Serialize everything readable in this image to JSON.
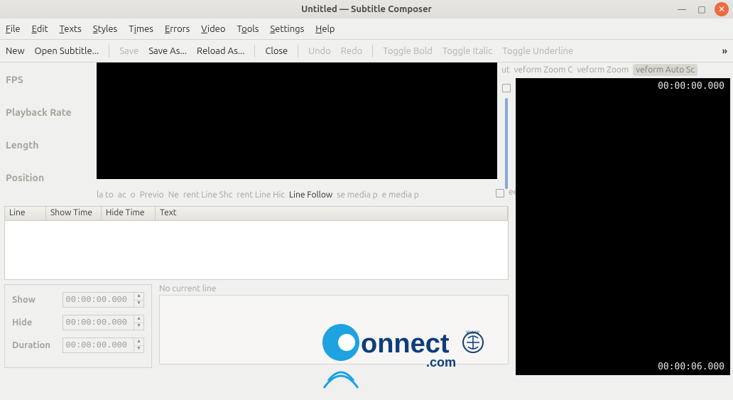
{
  "title": "Untitled  — Subtitle Composer",
  "window_buttons": {
    "minimize": "—",
    "maximize": "□",
    "close": "✕"
  },
  "menu": {
    "file": {
      "u": "F",
      "rest": "ile"
    },
    "edit": {
      "u": "E",
      "rest": "dit"
    },
    "texts": {
      "u": "T",
      "rest": "exts"
    },
    "styles": {
      "u": "S",
      "rest": "tyles"
    },
    "times": {
      "pre": "T",
      "u": "i",
      "rest": "mes"
    },
    "errors": {
      "u": "E",
      "rest": "rrors"
    },
    "video": {
      "u": "V",
      "rest": "ideo"
    },
    "tools": {
      "pre": "T",
      "u": "o",
      "rest": "ols"
    },
    "settings": {
      "u": "S",
      "rest": "ettings"
    },
    "help": {
      "u": "H",
      "rest": "elp"
    }
  },
  "toolbar": {
    "new": "New",
    "open": "Open Subtitle...",
    "save": "Save",
    "saveas": "Save As...",
    "reload": "Reload As...",
    "close": "Close",
    "undo": "Undo",
    "redo": "Redo",
    "bold": "Toggle Bold",
    "italic": "Toggle Italic",
    "underline": "Toggle Underline",
    "overflow": "»"
  },
  "sidelabels": {
    "fps": "FPS",
    "rate": "Playback Rate",
    "length": "Length",
    "position": "Position"
  },
  "waveform_toolbar": {
    "btn1": "ut",
    "btn2": "veform Zoom C",
    "btn3": "veform Zoom",
    "btn4": "veform Auto Sc"
  },
  "waveform_timecodes": {
    "top": "00:00:00.000",
    "bottom": "00:00:06.000"
  },
  "mini_toolbar": {
    "t1": "la to",
    "t2": "ac",
    "t3": "o",
    "t4": "Previo",
    "t5": "Ne",
    "t6": "rent Line Shc",
    "t7": "rent Line Hic",
    "t8": "Line Follow",
    "t9": "se media p",
    "t10": "e media p",
    "t11": "ee"
  },
  "table": {
    "headers": {
      "line": "Line",
      "show": "Show Time",
      "hide": "Hide Time",
      "text": "Text"
    }
  },
  "time_panel": {
    "show_label": "Show",
    "show_value": "00:00:00.000",
    "hide_label": "Hide",
    "hide_value": "00:00:00.000",
    "duration_label": "Duration",
    "duration_value": "00:00:00.000"
  },
  "editor": {
    "no_current_line": "No current line"
  },
  "logo": {
    "word": "onnect",
    "sub": ".com"
  }
}
